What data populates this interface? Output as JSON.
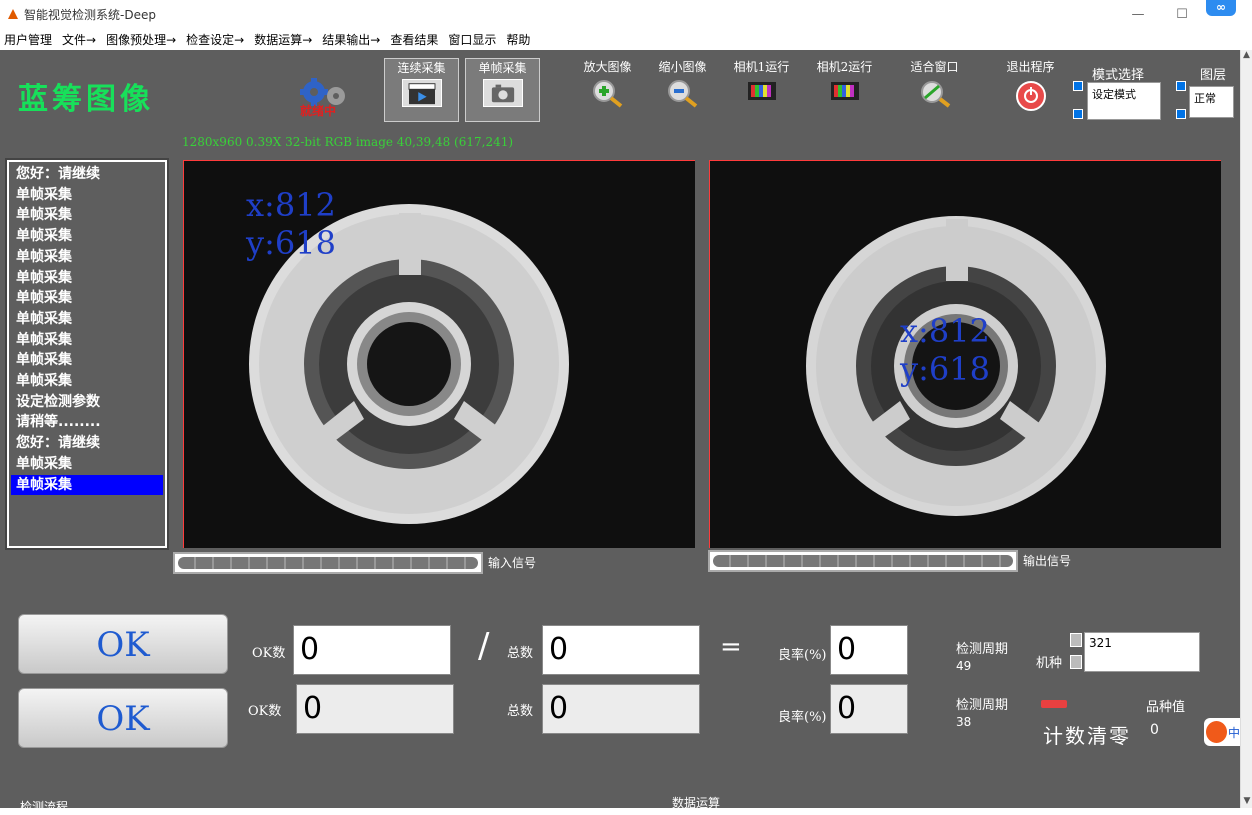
{
  "window": {
    "title": "智能视觉检测系统-Deep",
    "minimize": "—",
    "maximize": "☐"
  },
  "menu": [
    "用户管理",
    "文件→",
    "图像预处理→",
    "检查设定→",
    "数据运算→",
    "结果输出→",
    "查看结果",
    "窗口显示",
    "帮助"
  ],
  "brand": "蓝筹图像",
  "gear_status": "就绪中",
  "toolbar": {
    "continuous": "连续采集",
    "single": "单帧采集",
    "zoom_in": "放大图像",
    "zoom_out": "缩小图像",
    "cam1": "相机1运行",
    "cam2": "相机2运行",
    "fit": "适合窗口",
    "exit": "退出程序",
    "mode_label": "模式选择",
    "mode_value": "设定模式",
    "layer_label": "图层",
    "layer_value": "正常"
  },
  "image_info": "1280x960 0.39X 32-bit RGB image 40,39,48   (617,241)",
  "log": [
    "您好：请继续",
    "单帧采集",
    "单帧采集",
    "单帧采集",
    "单帧采集",
    "单帧采集",
    "单帧采集",
    "单帧采集",
    "单帧采集",
    "单帧采集",
    "单帧采集",
    "设定检测参数",
    "请稍等........",
    "您好：请继续",
    "单帧采集",
    "单帧采集"
  ],
  "log_selected_index": 15,
  "cam1": {
    "x": "x:812",
    "y": "y:618"
  },
  "cam2": {
    "x": "x:812",
    "y": "y:618"
  },
  "signals": {
    "input": "输入信号",
    "output": "输出信号"
  },
  "row1": {
    "result": "OK",
    "ok_label": "OK数",
    "ok_value": "0",
    "total_label": "总数",
    "total_value": "0",
    "rate_label": "良率(%)",
    "rate_value": "0",
    "cycle_label": "检测周期",
    "cycle_value": "49",
    "model_label": "机种",
    "model_value": "321"
  },
  "row2": {
    "result": "OK",
    "ok_label": "OK数",
    "ok_value": "0",
    "total_label": "总数",
    "total_value": "0",
    "rate_label": "良率(%)",
    "rate_value": "0",
    "cycle_label": "检测周期",
    "cycle_value": "38",
    "variety_label": "品种值",
    "variety_value": "0",
    "reset_label": "计数清零"
  },
  "slash": "/",
  "equals": "=",
  "footer": {
    "left": "检测流程",
    "center": "数据运算"
  },
  "ime": "中"
}
